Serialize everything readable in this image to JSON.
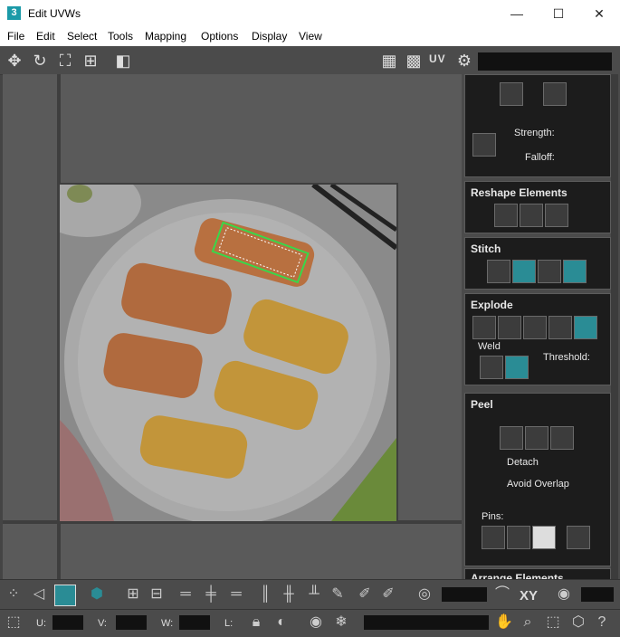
{
  "window": {
    "app_icon": "3",
    "title": "Edit UVWs",
    "minimize": "—",
    "maximize": "☐",
    "close": "✕"
  },
  "menu": [
    "File",
    "Edit",
    "Select",
    "Tools",
    "Mapping",
    "Options",
    "Display",
    "View"
  ],
  "toolbar": {
    "uv_label": "UV"
  },
  "panels": {
    "brush": {
      "strength_label": "Strength:",
      "falloff_label": "Falloff:"
    },
    "reshape": {
      "title": "Reshape Elements"
    },
    "stitch": {
      "title": "Stitch"
    },
    "explode": {
      "title": "Explode",
      "weld_label": "Weld",
      "threshold_label": "Threshold:"
    },
    "peel": {
      "title": "Peel",
      "detach_label": "Detach",
      "avoid_overlap_label": "Avoid Overlap",
      "pins_label": "Pins:"
    },
    "arrange": {
      "title": "Arrange Elements"
    }
  },
  "bottom_bar": {
    "xy_label": "XY",
    "u_label": "U:",
    "v_label": "V:",
    "w_label": "W:",
    "l_label": "L:"
  },
  "colors": {
    "accent_teal": "#2a8c95",
    "selection_green": "#38d84a",
    "panel_bg": "#1c1c1c",
    "toolbar_bg": "#4b4b4b"
  }
}
